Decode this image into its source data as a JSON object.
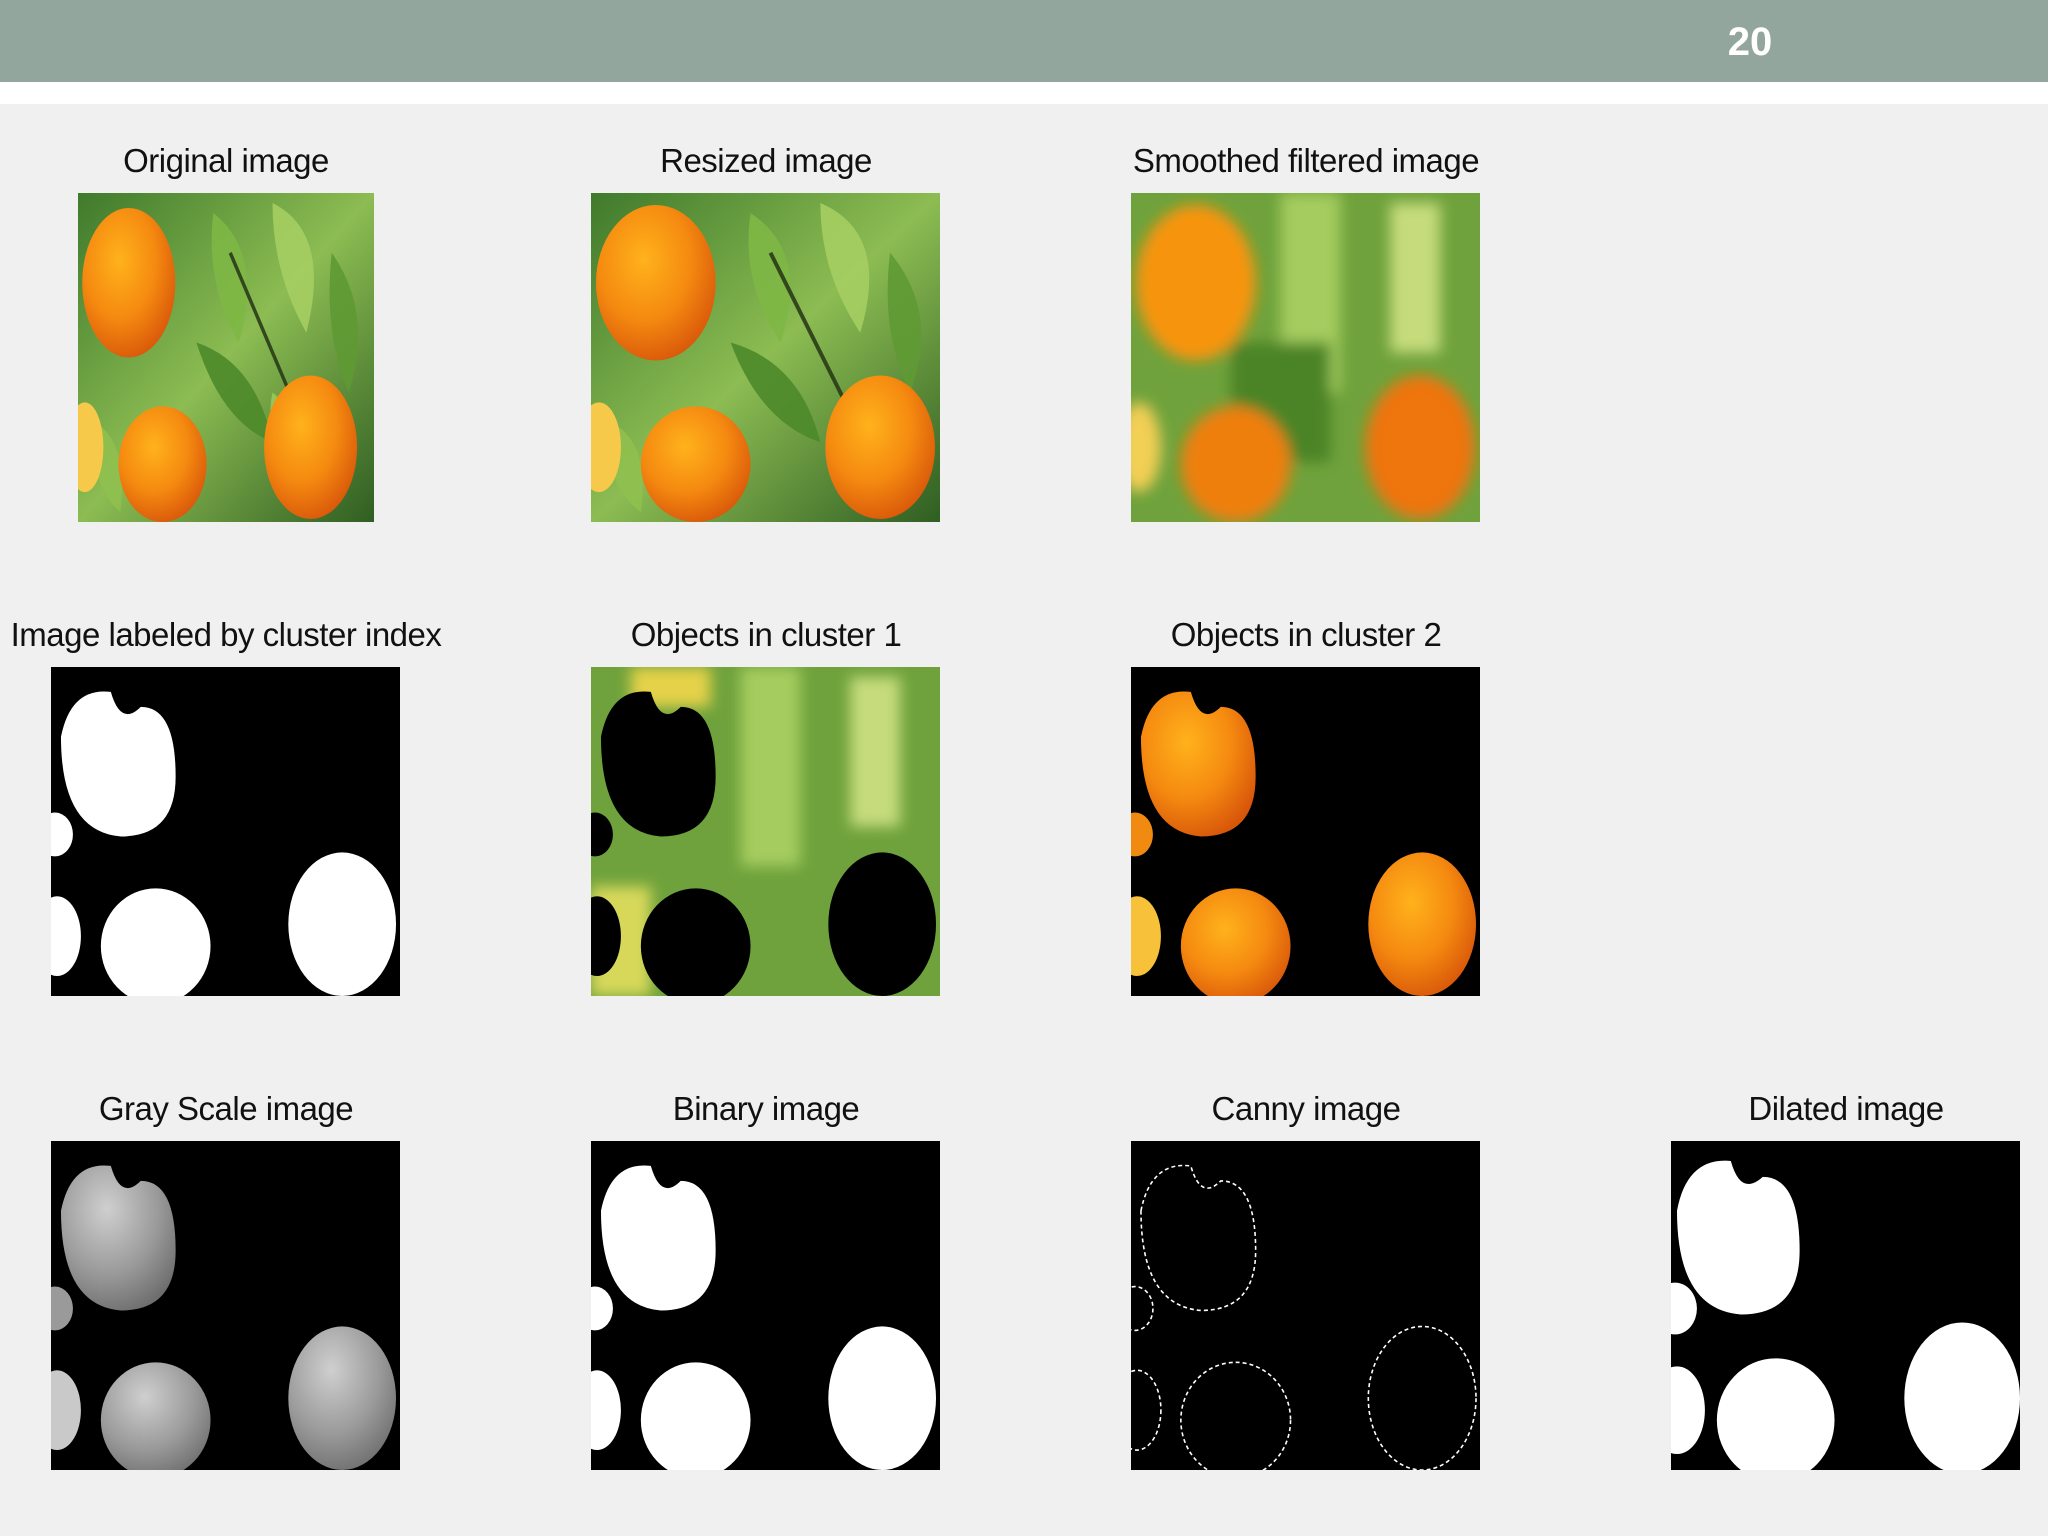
{
  "slide": {
    "page_number": "20"
  },
  "panels": [
    {
      "title": "Original image"
    },
    {
      "title": "Resized image"
    },
    {
      "title": "Smoothed filtered image"
    },
    {
      "title": "Image labeled by cluster index"
    },
    {
      "title": "Objects in cluster 1"
    },
    {
      "title": "Objects in cluster 2"
    },
    {
      "title": "Gray Scale image"
    },
    {
      "title": "Binary image"
    },
    {
      "title": "Canny image"
    },
    {
      "title": "Dilated image"
    }
  ],
  "colors": {
    "header": "#93a69d",
    "background": "#f0f0f1",
    "orange": "#f0800f",
    "leaf": "#5e9a2e"
  }
}
